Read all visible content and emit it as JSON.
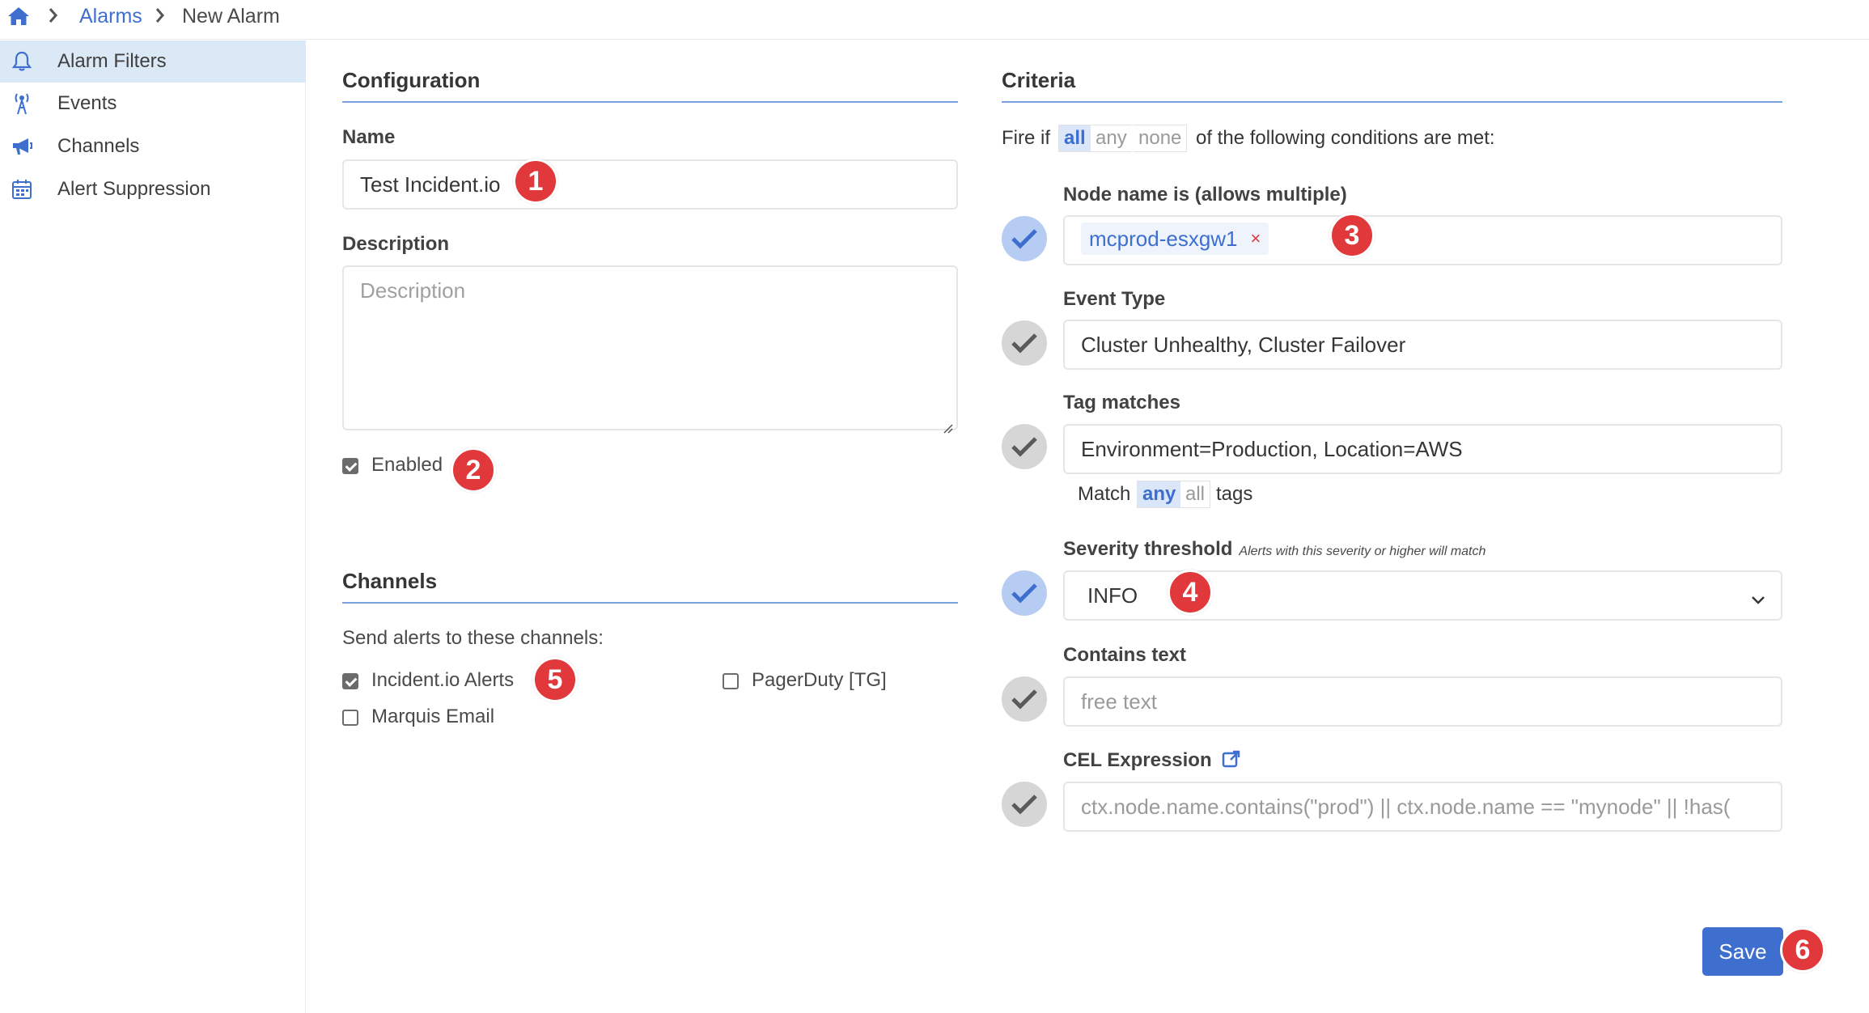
{
  "breadcrumb": {
    "items": [
      "Alarms",
      "New Alarm"
    ]
  },
  "sidebar": {
    "items": [
      {
        "label": "Alarm Filters",
        "icon": "bell-icon",
        "active": true
      },
      {
        "label": "Events",
        "icon": "antenna-icon"
      },
      {
        "label": "Channels",
        "icon": "megaphone-icon"
      },
      {
        "label": "Alert Suppression",
        "icon": "calendar-icon"
      }
    ]
  },
  "configuration": {
    "title": "Configuration",
    "name_label": "Name",
    "name_value": "Test Incident.io",
    "description_label": "Description",
    "description_placeholder": "Description",
    "enabled_label": "Enabled",
    "enabled": true
  },
  "channels": {
    "title": "Channels",
    "prompt": "Send alerts to these channels:",
    "options": [
      {
        "label": "Incident.io Alerts",
        "checked": true
      },
      {
        "label": "PagerDuty [TG]",
        "checked": false
      },
      {
        "label": "Marquis Email",
        "checked": false
      }
    ]
  },
  "criteria": {
    "title": "Criteria",
    "fire_prefix": "Fire if",
    "fire_modes": [
      "all",
      "any",
      "none"
    ],
    "fire_selected": "all",
    "fire_suffix": "of the following conditions are met:",
    "node_name": {
      "label": "Node name is (allows multiple)",
      "tag": "mcprod-esxgw1",
      "tag_remove": "×",
      "enabled": true
    },
    "event_type": {
      "label": "Event Type",
      "value": "Cluster Unhealthy, Cluster Failover",
      "enabled": false
    },
    "tag_matches": {
      "label": "Tag matches",
      "value": "Environment=Production, Location=AWS",
      "match_prefix": "Match",
      "modes": [
        "any",
        "all"
      ],
      "selected": "any",
      "match_suffix": "tags",
      "enabled": false
    },
    "severity": {
      "label": "Severity threshold",
      "hint": "Alerts with this severity or higher will match",
      "value": "INFO",
      "enabled": true
    },
    "contains_text": {
      "label": "Contains text",
      "placeholder": "free text",
      "enabled": false
    },
    "cel": {
      "label": "CEL Expression",
      "placeholder": "ctx.node.name.contains(\"prod\") || ctx.node.name == \"mynode\" || !has(",
      "enabled": false
    }
  },
  "actions": {
    "save_label": "Save"
  },
  "markers": [
    "1",
    "2",
    "3",
    "4",
    "5",
    "6"
  ],
  "colors": {
    "accent": "#3e6fcf",
    "marker": "#e0383b",
    "active_nav": "#dbe9f7"
  }
}
